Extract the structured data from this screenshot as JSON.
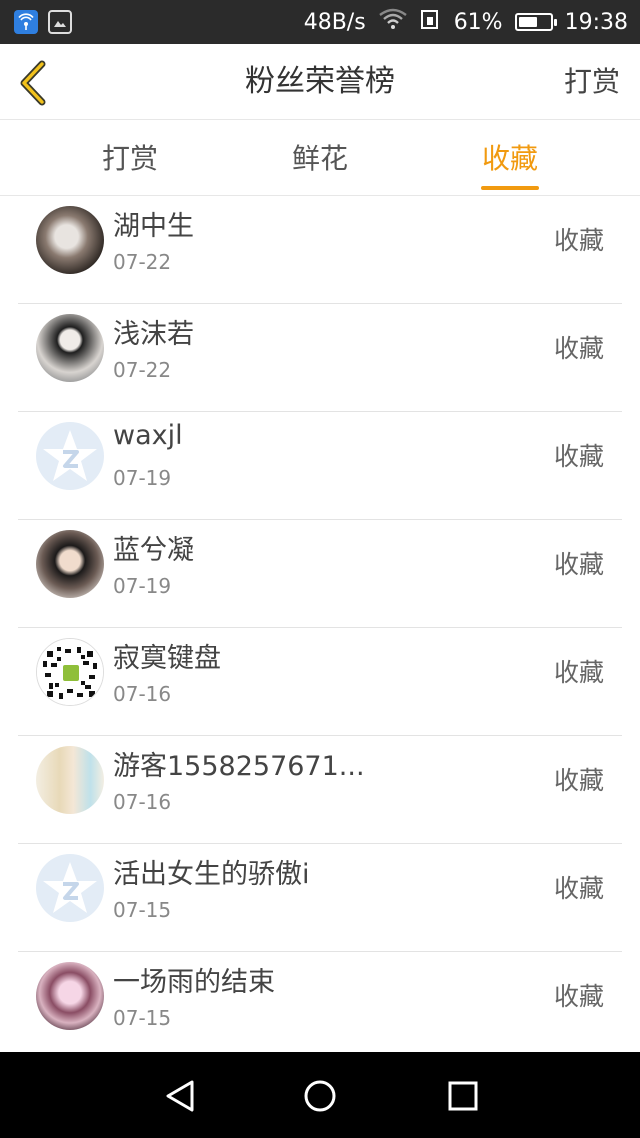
{
  "status_bar": {
    "network_speed": "48B/s",
    "battery_percent": "61%",
    "battery_level": 0.61,
    "time": "19:38"
  },
  "header": {
    "title": "粉丝荣誉榜",
    "right_action": "打赏"
  },
  "tabs": [
    {
      "label": "打赏",
      "active": false
    },
    {
      "label": "鲜花",
      "active": false
    },
    {
      "label": "收藏",
      "active": true
    }
  ],
  "accent_color": "#f19a10",
  "rows": [
    {
      "name": "湖中生",
      "date": "07-22",
      "action": "收藏",
      "avatar": "photo-avatar"
    },
    {
      "name": "浅沫若",
      "date": "07-22",
      "action": "收藏",
      "avatar": "photo-avatar"
    },
    {
      "name": "waxjl",
      "date": "07-19",
      "action": "收藏",
      "avatar": "default-qq-avatar"
    },
    {
      "name": "蓝兮凝",
      "date": "07-19",
      "action": "收藏",
      "avatar": "photo-avatar"
    },
    {
      "name": "寂寞键盘",
      "date": "07-16",
      "action": "收藏",
      "avatar": "qr-code-avatar"
    },
    {
      "name": "游客1558257671...",
      "date": "07-16",
      "action": "收藏",
      "avatar": "anime-avatar"
    },
    {
      "name": "活出女生的骄傲i",
      "date": "07-15",
      "action": "收藏",
      "avatar": "default-qq-avatar"
    },
    {
      "name": "一场雨的结束",
      "date": "07-15",
      "action": "收藏",
      "avatar": "photo-avatar"
    }
  ]
}
